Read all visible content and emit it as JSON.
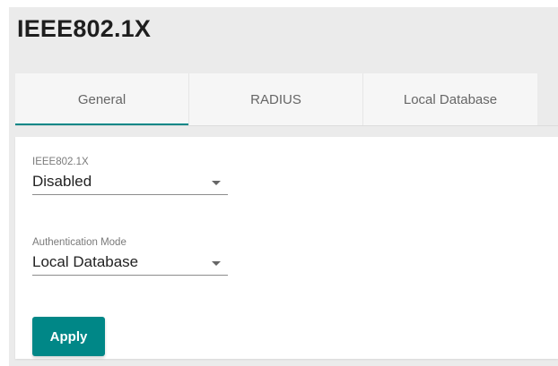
{
  "page": {
    "title": "IEEE802.1X"
  },
  "tabs": [
    {
      "label": "General",
      "active": true
    },
    {
      "label": "RADIUS",
      "active": false
    },
    {
      "label": "Local Database",
      "active": false
    }
  ],
  "form": {
    "ieee8021x": {
      "label": "IEEE802.1X",
      "value": "Disabled"
    },
    "auth_mode": {
      "label": "Authentication Mode",
      "value": "Local Database"
    },
    "apply_label": "Apply"
  },
  "colors": {
    "accent": "#008787",
    "page_background": "#ebebeb"
  }
}
